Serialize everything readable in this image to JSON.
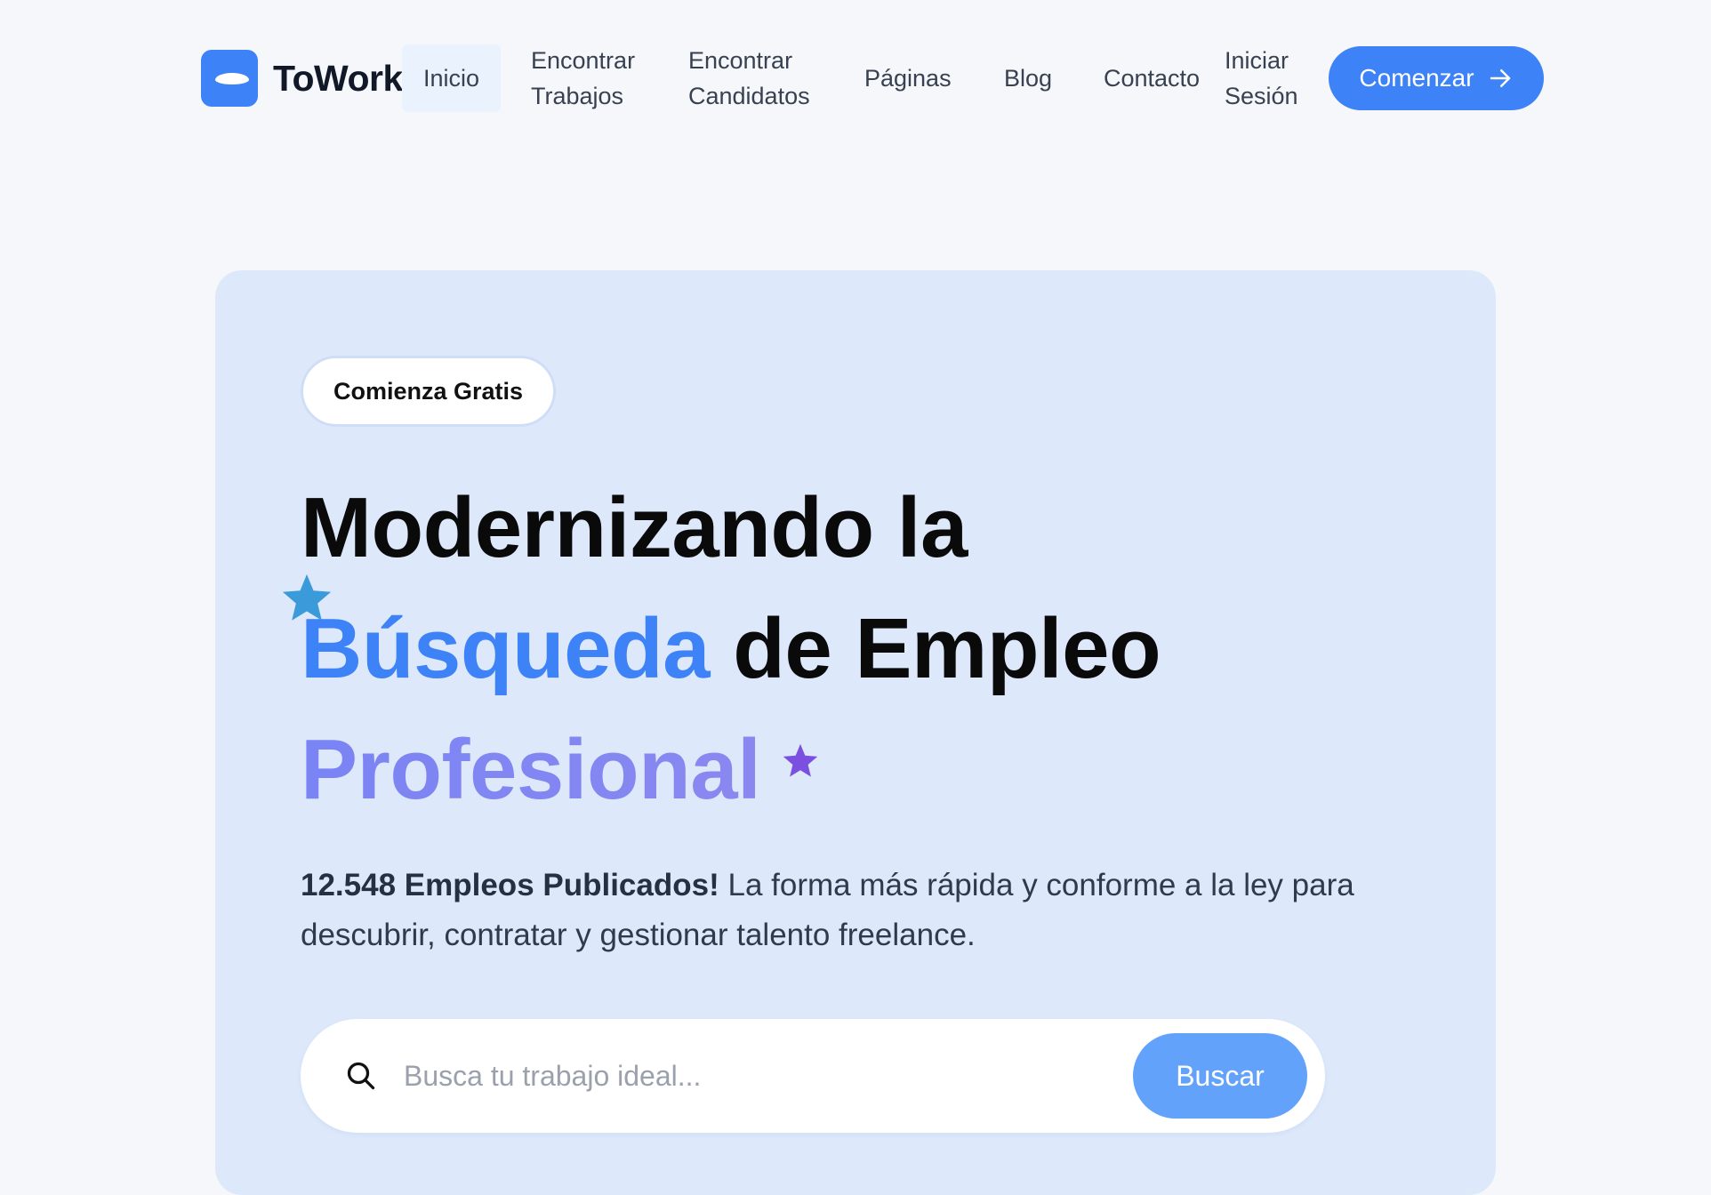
{
  "brand": {
    "name": "ToWork"
  },
  "nav": {
    "items": [
      {
        "line1": "Inicio",
        "line2": ""
      },
      {
        "line1": "Encontrar",
        "line2": "Trabajos"
      },
      {
        "line1": "Encontrar",
        "line2": "Candidatos"
      },
      {
        "line1": "Páginas",
        "line2": ""
      },
      {
        "line1": "Blog",
        "line2": ""
      },
      {
        "line1": "Contacto",
        "line2": ""
      },
      {
        "line1": "Iniciar",
        "line2": "Sesión"
      }
    ],
    "active": "Inicio",
    "cta_label": "Comenzar"
  },
  "hero": {
    "badge": "Comienza Gratis",
    "headline": {
      "line1": "Modernizando la",
      "highlight_blue": "Búsqueda",
      "line2_rest": "de Empleo",
      "highlight_purple": "Profesional"
    },
    "subtext_bold": "12.548 Empleos Publicados!",
    "subtext_rest": "La forma más rápida y conforme a la ley para descubrir, contratar y gestionar talento freelance.",
    "search": {
      "placeholder": "Busca tu trabajo ideal...",
      "value": "",
      "button_label": "Buscar"
    }
  },
  "colors": {
    "accent": "#3d82f6",
    "hero_bg": "#dde9fb",
    "purple": "#7a84f4",
    "star_blue": "#3b9ad9",
    "star_purple": "#7b4fe0",
    "search_button": "#63a2fb"
  },
  "icons": [
    "logo-icon",
    "arrow-right-icon",
    "star-icon",
    "search-icon"
  ]
}
